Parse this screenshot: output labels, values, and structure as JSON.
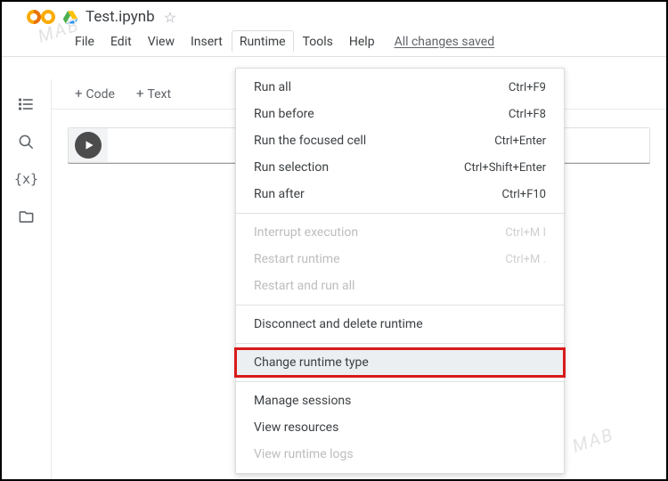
{
  "header": {
    "filename": "Test.ipynb",
    "save_status": "All changes saved"
  },
  "menubar": {
    "file": "File",
    "edit": "Edit",
    "view": "View",
    "insert": "Insert",
    "runtime": "Runtime",
    "tools": "Tools",
    "help": "Help"
  },
  "toolbar": {
    "code": "Code",
    "text": "Text"
  },
  "dropdown": {
    "run_all": {
      "label": "Run all",
      "shortcut": "Ctrl+F9"
    },
    "run_before": {
      "label": "Run before",
      "shortcut": "Ctrl+F8"
    },
    "run_focused": {
      "label": "Run the focused cell",
      "shortcut": "Ctrl+Enter"
    },
    "run_selection": {
      "label": "Run selection",
      "shortcut": "Ctrl+Shift+Enter"
    },
    "run_after": {
      "label": "Run after",
      "shortcut": "Ctrl+F10"
    },
    "interrupt": {
      "label": "Interrupt execution",
      "shortcut": "Ctrl+M I"
    },
    "restart": {
      "label": "Restart runtime",
      "shortcut": "Ctrl+M ."
    },
    "restart_all": {
      "label": "Restart and run all"
    },
    "disconnect": {
      "label": "Disconnect and delete runtime"
    },
    "change_type": {
      "label": "Change runtime type"
    },
    "manage": {
      "label": "Manage sessions"
    },
    "resources": {
      "label": "View resources"
    },
    "logs": {
      "label": "View runtime logs"
    }
  },
  "watermark": "MAB"
}
